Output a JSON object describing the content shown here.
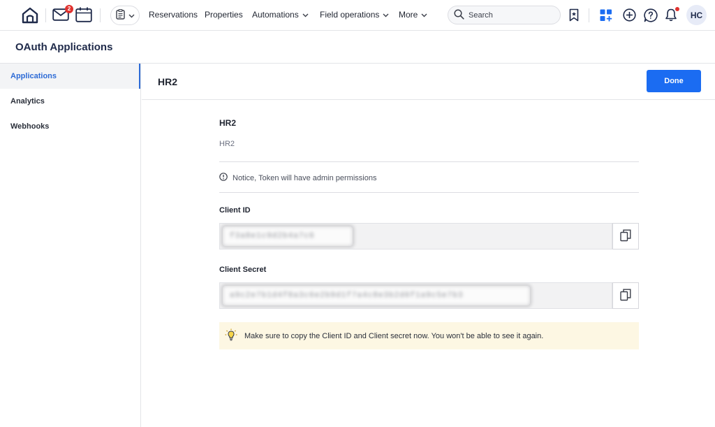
{
  "nav": {
    "mail_badge": "2",
    "menu": [
      {
        "label": "Reservations",
        "has_chevron": false
      },
      {
        "label": "Properties",
        "has_chevron": false
      },
      {
        "label": "Automations",
        "has_chevron": true
      },
      {
        "label": "Field operations",
        "has_chevron": true
      },
      {
        "label": "More",
        "has_chevron": true
      }
    ],
    "search_placeholder": "Search",
    "avatar_initials": "HC",
    "icons": [
      "home-icon",
      "mail-icon",
      "calendar-icon",
      "clipboard-icon",
      "chevron-down-icon",
      "search-icon",
      "bookmark-icon",
      "apps-grid-icon",
      "plus-circle-icon",
      "help-icon",
      "bell-icon"
    ],
    "accent_color": "#1b6cf2",
    "badge_color": "#e0322f"
  },
  "page": {
    "title": "OAuth Applications"
  },
  "sidebar": {
    "items": [
      {
        "label": "Applications",
        "active": true
      },
      {
        "label": "Analytics",
        "active": false
      },
      {
        "label": "Webhooks",
        "active": false
      }
    ]
  },
  "main": {
    "title": "HR2",
    "done_label": "Done",
    "app_name": "HR2",
    "app_description": "HR2",
    "notice": "Notice, Token will have admin permissions",
    "client_id_label": "Client ID",
    "client_id_value": "f3a8e1c9d2b4a7c6",
    "client_secret_label": "Client Secret",
    "client_secret_value": "a9c2e7b1d4f8a3c6e2b9d1f7a4c8e3b2d6f1a9c5e7b3",
    "tip": "Make sure to copy the Client ID and Client secret now. You won't be able to see it again."
  }
}
